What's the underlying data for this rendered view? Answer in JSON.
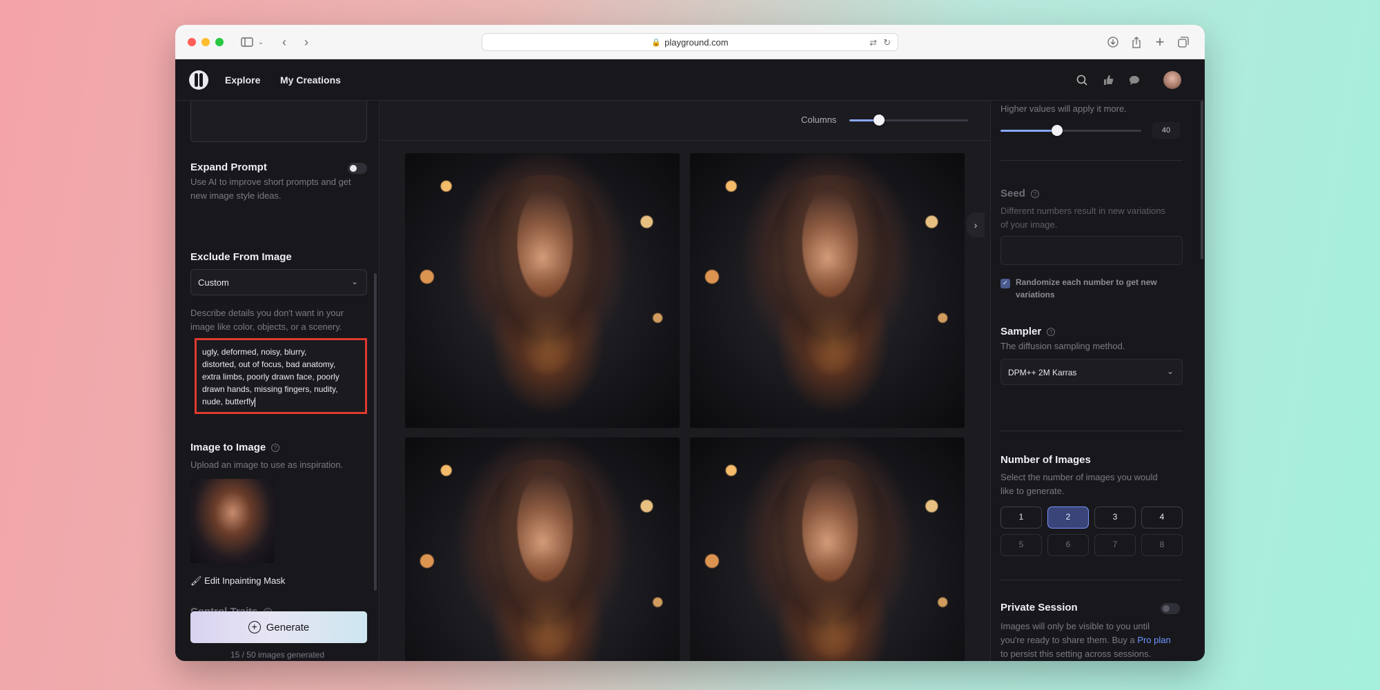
{
  "browser": {
    "url": "playground.com"
  },
  "header": {
    "nav": [
      "Explore",
      "My Creations"
    ]
  },
  "left_panel": {
    "expand_prompt": {
      "title": "Expand Prompt",
      "description_1": "Use AI to improve short prompts and get",
      "description_2": "new image style ideas.",
      "enabled": false
    },
    "exclude": {
      "title": "Exclude From Image",
      "select_value": "Custom",
      "description_1": "Describe details you don't want in your",
      "description_2": "image like color, objects, or a scenery.",
      "lines": [
        "ugly, deformed, noisy, blurry,",
        "distorted, out of focus, bad anatomy,",
        "extra limbs, poorly drawn face, poorly",
        "drawn hands, missing fingers, nudity,",
        "nude, butterfly"
      ]
    },
    "image_to_image": {
      "title": "Image to Image",
      "description": "Upload an image to use as inspiration.",
      "edit_mask": "Edit Inpainting Mask"
    },
    "control_traits": "Control Traits",
    "generate_label": "Generate",
    "images_generated": "15 / 50 images generated"
  },
  "gallery": {
    "columns_label": "Columns",
    "columns_level": 0.25,
    "image_count": 4
  },
  "right_panel": {
    "guidance": {
      "description": "Higher values will apply it more.",
      "value": "40"
    },
    "seed": {
      "title": "Seed",
      "description_1": "Different numbers result in new variations",
      "description_2": "of your image.",
      "randomize_1": "Randomize each number to get new",
      "randomize_2": "variations",
      "randomize_checked": true
    },
    "sampler": {
      "title": "Sampler",
      "description": "The diffusion sampling method.",
      "value": "DPM++ 2M Karras"
    },
    "number_of_images": {
      "title": "Number of Images",
      "description_1": "Select the number of images you would",
      "description_2": "like to generate.",
      "options": [
        "1",
        "2",
        "3",
        "4",
        "5",
        "6",
        "7",
        "8"
      ],
      "selected": "2"
    },
    "private_session": {
      "title": "Private Session",
      "description_1": "Images will only be visible to you until",
      "description_2": "you're ready to share them. Buy a ",
      "link": "Pro plan",
      "description_3": "to persist this setting across sessions."
    }
  },
  "colors": {
    "accent": "#7c97ff",
    "highlight_border": "#e03a2e",
    "background": "#18181c"
  }
}
